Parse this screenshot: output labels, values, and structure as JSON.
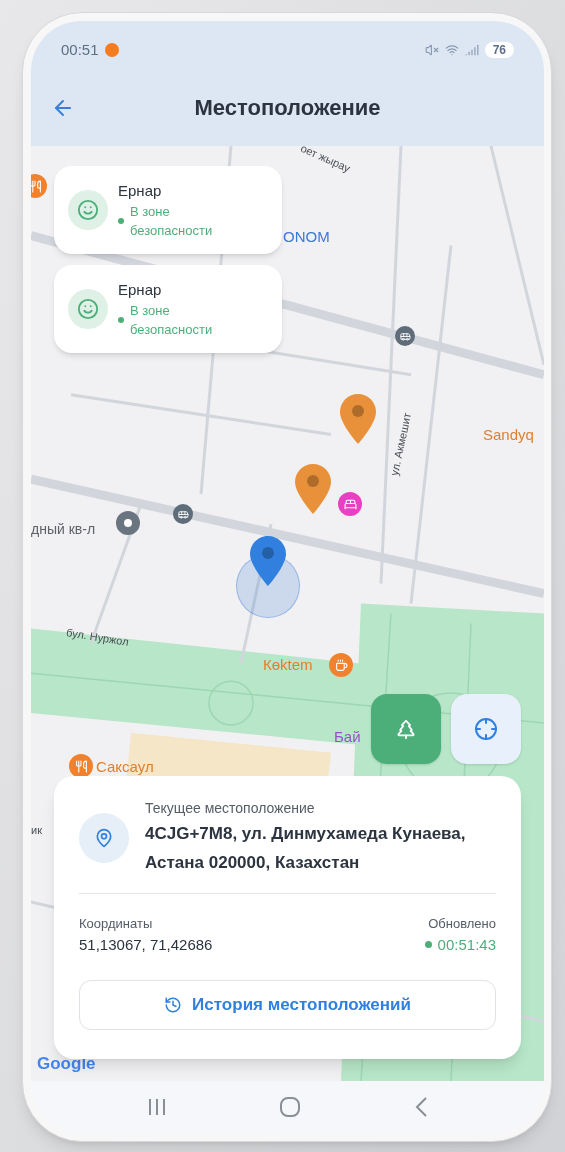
{
  "status_bar": {
    "time": "00:51",
    "battery": "76"
  },
  "header": {
    "title": "Местоположение"
  },
  "map": {
    "labels": [
      {
        "text": "оет жырау",
        "kind": "street"
      },
      {
        "text": "ONOM",
        "kind": "shop"
      },
      {
        "text": "ул. Акмешит",
        "kind": "street"
      },
      {
        "text": "Sandyq",
        "kind": "food"
      },
      {
        "text": "дный кв-л",
        "kind": "district"
      },
      {
        "text": "бул. Нуржол",
        "kind": "street"
      },
      {
        "text": "Көktem",
        "kind": "food"
      },
      {
        "text": "Бай",
        "kind": "park"
      },
      {
        "text": "Саксаул",
        "kind": "food"
      },
      {
        "text": "ик",
        "kind": "street"
      }
    ],
    "attribution": "Google"
  },
  "children_cards": [
    {
      "name": "Ернар",
      "status": "В зоне безопасности"
    },
    {
      "name": "Ернар",
      "status": "В зоне безопасности"
    }
  ],
  "location_card": {
    "title": "Текущее местоположение",
    "address": "4CJG+7M8, ул. Динмухамеда Кунаева, Астана 020000, Казахстан",
    "coordinates_label": "Координаты",
    "coordinates": "51,13067, 71,42686",
    "updated_label": "Обновлено",
    "updated_time": "00:51:43",
    "history_button": "История местоположений"
  }
}
